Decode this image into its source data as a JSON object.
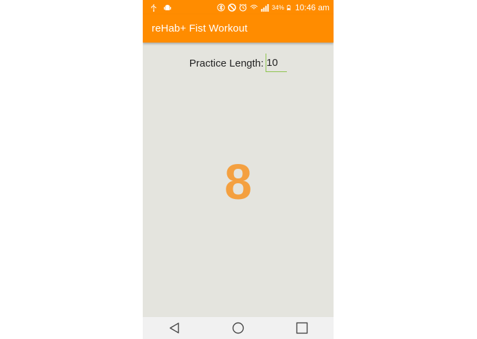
{
  "status_bar": {
    "icons_left": [
      "usb-icon",
      "android-icon"
    ],
    "icons_right": [
      "bluetooth-icon",
      "do-not-disturb-icon",
      "alarm-icon",
      "wifi-icon",
      "signal-icon",
      "battery-icon"
    ],
    "battery_percent": "34%",
    "time": "10:46 am"
  },
  "app_bar": {
    "title": "reHab+ Fist Workout",
    "background_color": "#ff8c00"
  },
  "practice": {
    "label": "Practice Length:",
    "value": "10"
  },
  "counter": {
    "value": "8",
    "color": "#f4a040"
  },
  "nav_bar": {
    "buttons": [
      "back-icon",
      "home-icon",
      "recents-icon"
    ]
  }
}
